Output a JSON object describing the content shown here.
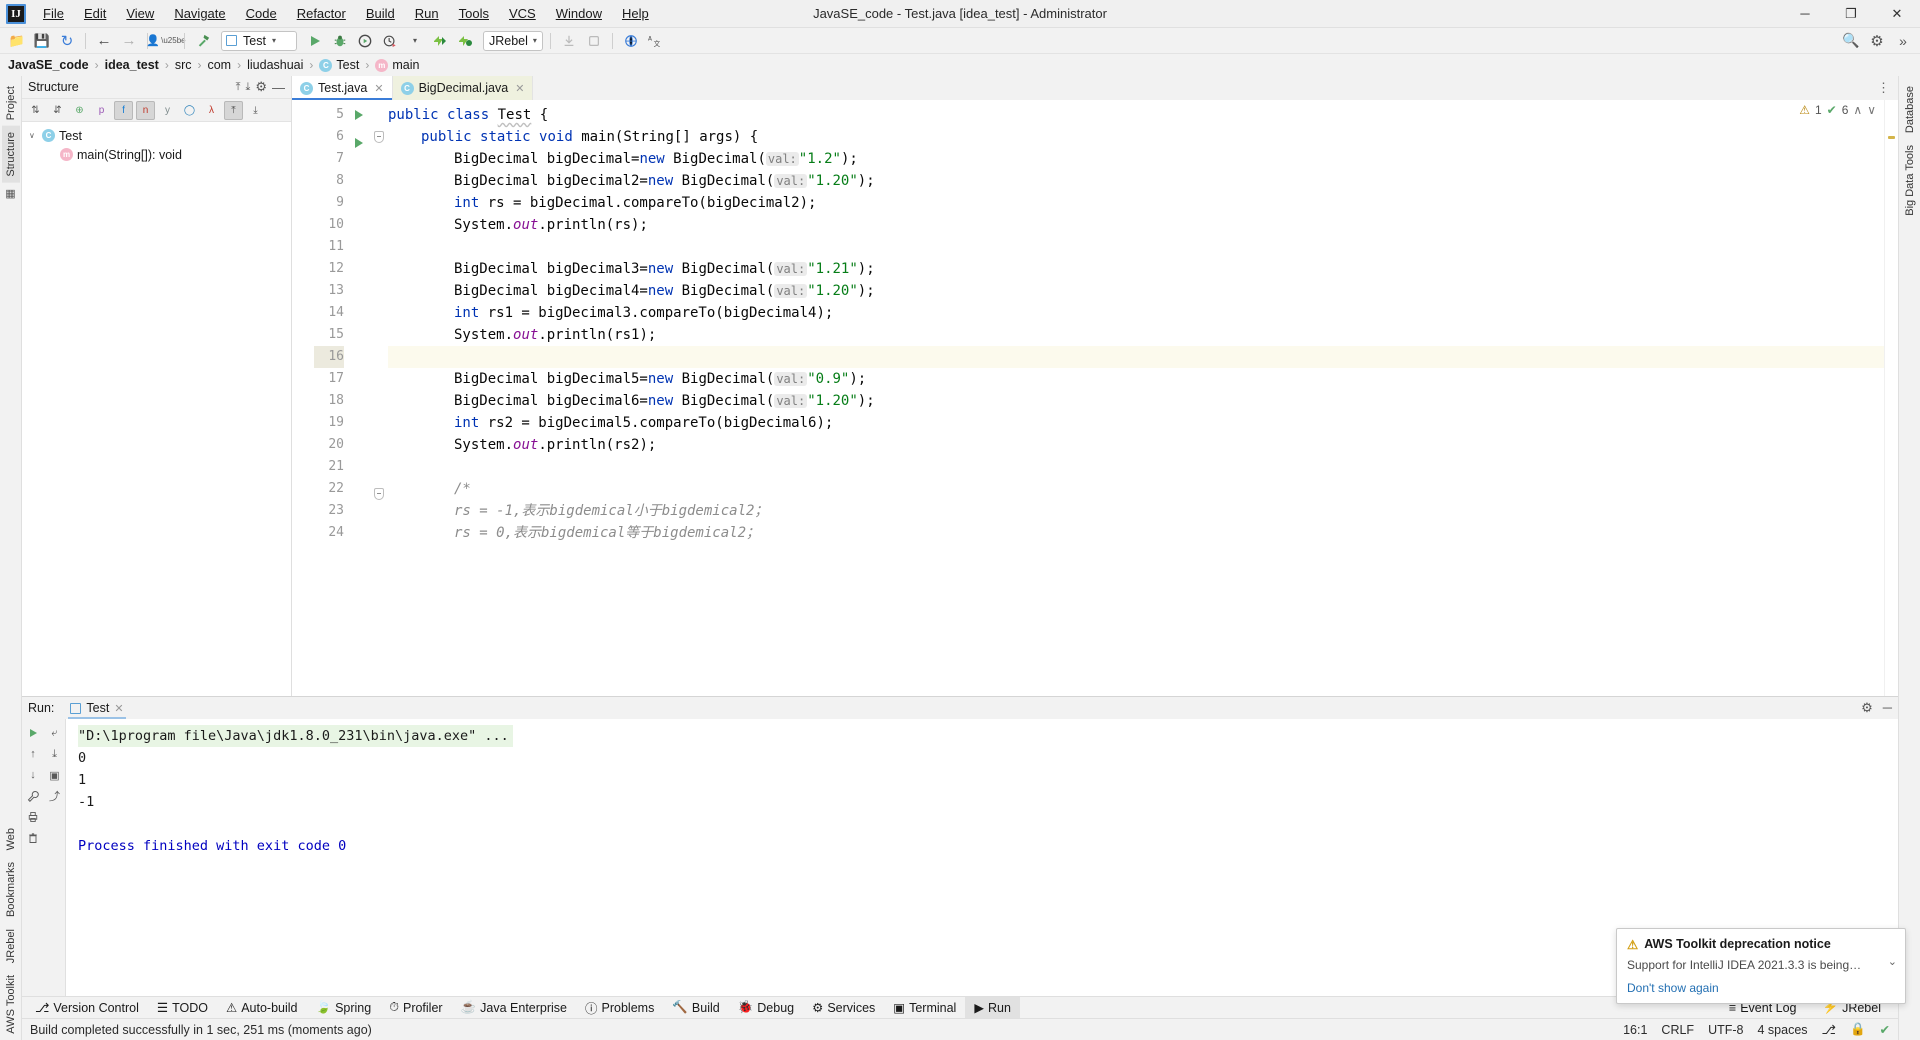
{
  "titlebar": {
    "logo": "IJ",
    "window_title": "JavaSE_code - Test.java [idea_test] - Administrator",
    "menu": [
      {
        "label": "File"
      },
      {
        "label": "Edit"
      },
      {
        "label": "View"
      },
      {
        "label": "Navigate"
      },
      {
        "label": "Code"
      },
      {
        "label": "Refactor"
      },
      {
        "label": "Build"
      },
      {
        "label": "Run"
      },
      {
        "label": "Tools"
      },
      {
        "label": "VCS"
      },
      {
        "label": "Window"
      },
      {
        "label": "Help"
      }
    ],
    "minimize": "─",
    "maximize": "❐",
    "close": "✕"
  },
  "toolbar": {
    "open_icon": "📁",
    "save_icon": "💾",
    "sync_icon": "↻",
    "back_icon": "←",
    "forward_icon": "→",
    "profile_icon": "👤",
    "build_icon": "🔨",
    "run_config_name": "Test",
    "run_icon": "▶",
    "debug_icon": "🐞",
    "run_coverage_icon": "▶",
    "profiler_icon": "⏱",
    "jrebel_run_icon": "⚡",
    "jrebel_debug_icon": "⚡",
    "jrebel_label": "JRebel",
    "search_icon": "🔍",
    "settings_icon": "⚙",
    "expand_icon": "»"
  },
  "breadcrumb": {
    "items": [
      {
        "label": "JavaSE_code",
        "bold": true,
        "icon": null
      },
      {
        "label": "idea_test",
        "bold": true,
        "icon": null
      },
      {
        "label": "src",
        "bold": false,
        "icon": null
      },
      {
        "label": "com",
        "bold": false,
        "icon": null
      },
      {
        "label": "liudashuai",
        "bold": false,
        "icon": null
      },
      {
        "label": "Test",
        "bold": false,
        "icon": "C"
      },
      {
        "label": "main",
        "bold": false,
        "icon": "m"
      }
    ],
    "separator": "›"
  },
  "left_strip": {
    "project_tab": "Project",
    "structure_tab": "Structure",
    "bottom_tabs": [
      "Web",
      "Bookmarks",
      "JRebel",
      "AWS Toolkit"
    ],
    "icons": [
      "pin-icon",
      "star-icon"
    ]
  },
  "right_strip": {
    "tabs": [
      "Database",
      "Big Data Tools"
    ]
  },
  "structure": {
    "title": "Structure",
    "header_actions": [
      "collapse-all-icon",
      "expand-all-icon",
      "gear-icon",
      "hide-icon"
    ],
    "toolbar_buttons": [
      "sort-alpha-icon",
      "sort-visibility-icon",
      "show-inherited-icon",
      "show-properties-icon",
      "show-fields-icon",
      "show-non-public-icon",
      "group-methods-icon",
      "show-anonymous-icon",
      "autoscroll-from-icon",
      "expand-all-icon",
      "collapse-all-icon"
    ],
    "tree": [
      {
        "label": "Test",
        "icon": "C",
        "indent": 0,
        "twisty": "∨"
      },
      {
        "label": "main(String[]): void",
        "icon": "m",
        "indent": 1,
        "twisty": ""
      }
    ]
  },
  "editor": {
    "tabs": [
      {
        "label": "Test.java",
        "icon": "C",
        "active": true,
        "close": "✕"
      },
      {
        "label": "BigDecimal.java",
        "icon": "C",
        "active": false,
        "close": "✕"
      }
    ],
    "status": {
      "warning_count": "1",
      "ok_count": "6",
      "warning_icon": "⚠",
      "ok_icon": "✔",
      "up_icon": "∧",
      "down_icon": "∨"
    },
    "first_line_number": 5,
    "highlighted_line": 16,
    "lines": [
      {
        "n": 5,
        "run": true,
        "fold": false,
        "indent": 0,
        "tokens": [
          {
            "t": "public ",
            "c": "kw"
          },
          {
            "t": "class ",
            "c": "kw"
          },
          {
            "t": "Test",
            "c": "typo"
          },
          {
            "t": " {",
            "c": ""
          }
        ]
      },
      {
        "n": 6,
        "run": true,
        "fold": true,
        "indent": 1,
        "tokens": [
          {
            "t": "public ",
            "c": "kw"
          },
          {
            "t": "static ",
            "c": "kw"
          },
          {
            "t": "void ",
            "c": "kw"
          },
          {
            "t": "main",
            "c": "mth"
          },
          {
            "t": "(String[] args) {",
            "c": ""
          }
        ]
      },
      {
        "n": 7,
        "run": false,
        "fold": false,
        "indent": 2,
        "tokens": [
          {
            "t": "BigDecimal bigDecimal=",
            "c": ""
          },
          {
            "t": "new ",
            "c": "kw"
          },
          {
            "t": "BigDecimal(",
            "c": ""
          },
          {
            "t": " val: ",
            "c": "hint"
          },
          {
            "t": "\"1.2\"",
            "c": "str"
          },
          {
            "t": ");",
            "c": ""
          }
        ]
      },
      {
        "n": 8,
        "run": false,
        "fold": false,
        "indent": 2,
        "tokens": [
          {
            "t": "BigDecimal bigDecimal2=",
            "c": ""
          },
          {
            "t": "new ",
            "c": "kw"
          },
          {
            "t": "BigDecimal(",
            "c": ""
          },
          {
            "t": " val: ",
            "c": "hint"
          },
          {
            "t": "\"1.20\"",
            "c": "str"
          },
          {
            "t": ");",
            "c": ""
          }
        ]
      },
      {
        "n": 9,
        "run": false,
        "fold": false,
        "indent": 2,
        "tokens": [
          {
            "t": "int ",
            "c": "kw"
          },
          {
            "t": "rs = bigDecimal.compareTo(bigDecimal2);",
            "c": ""
          }
        ]
      },
      {
        "n": 10,
        "run": false,
        "fold": false,
        "indent": 2,
        "tokens": [
          {
            "t": "System.",
            "c": ""
          },
          {
            "t": "out",
            "c": "fld"
          },
          {
            "t": ".println(rs);",
            "c": ""
          }
        ]
      },
      {
        "n": 11,
        "run": false,
        "fold": false,
        "indent": 2,
        "tokens": []
      },
      {
        "n": 12,
        "run": false,
        "fold": false,
        "indent": 2,
        "tokens": [
          {
            "t": "BigDecimal bigDecimal3=",
            "c": ""
          },
          {
            "t": "new ",
            "c": "kw"
          },
          {
            "t": "BigDecimal(",
            "c": ""
          },
          {
            "t": " val: ",
            "c": "hint"
          },
          {
            "t": "\"1.21\"",
            "c": "str"
          },
          {
            "t": ");",
            "c": ""
          }
        ]
      },
      {
        "n": 13,
        "run": false,
        "fold": false,
        "indent": 2,
        "tokens": [
          {
            "t": "BigDecimal bigDecimal4=",
            "c": ""
          },
          {
            "t": "new ",
            "c": "kw"
          },
          {
            "t": "BigDecimal(",
            "c": ""
          },
          {
            "t": " val: ",
            "c": "hint"
          },
          {
            "t": "\"1.20\"",
            "c": "str"
          },
          {
            "t": ");",
            "c": ""
          }
        ]
      },
      {
        "n": 14,
        "run": false,
        "fold": false,
        "indent": 2,
        "tokens": [
          {
            "t": "int ",
            "c": "kw"
          },
          {
            "t": "rs1 = bigDecimal3.compareTo(bigDecimal4);",
            "c": ""
          }
        ]
      },
      {
        "n": 15,
        "run": false,
        "fold": false,
        "indent": 2,
        "tokens": [
          {
            "t": "System.",
            "c": ""
          },
          {
            "t": "out",
            "c": "fld"
          },
          {
            "t": ".println(rs1);",
            "c": ""
          }
        ]
      },
      {
        "n": 16,
        "run": false,
        "fold": false,
        "indent": 2,
        "tokens": []
      },
      {
        "n": 17,
        "run": false,
        "fold": false,
        "indent": 2,
        "tokens": [
          {
            "t": "BigDecimal bigDecimal5=",
            "c": ""
          },
          {
            "t": "new ",
            "c": "kw"
          },
          {
            "t": "BigDecimal(",
            "c": ""
          },
          {
            "t": " val: ",
            "c": "hint"
          },
          {
            "t": "\"0.9\"",
            "c": "str"
          },
          {
            "t": ");",
            "c": ""
          }
        ]
      },
      {
        "n": 18,
        "run": false,
        "fold": false,
        "indent": 2,
        "tokens": [
          {
            "t": "BigDecimal bigDecimal6=",
            "c": ""
          },
          {
            "t": "new ",
            "c": "kw"
          },
          {
            "t": "BigDecimal(",
            "c": ""
          },
          {
            "t": " val: ",
            "c": "hint"
          },
          {
            "t": "\"1.20\"",
            "c": "str"
          },
          {
            "t": ");",
            "c": ""
          }
        ]
      },
      {
        "n": 19,
        "run": false,
        "fold": false,
        "indent": 2,
        "tokens": [
          {
            "t": "int ",
            "c": "kw"
          },
          {
            "t": "rs2 = bigDecimal5.compareTo(bigDecimal6);",
            "c": ""
          }
        ]
      },
      {
        "n": 20,
        "run": false,
        "fold": false,
        "indent": 2,
        "tokens": [
          {
            "t": "System.",
            "c": ""
          },
          {
            "t": "out",
            "c": "fld"
          },
          {
            "t": ".println(rs2);",
            "c": ""
          }
        ]
      },
      {
        "n": 21,
        "run": false,
        "fold": false,
        "indent": 2,
        "tokens": []
      },
      {
        "n": 22,
        "run": false,
        "fold": true,
        "indent": 2,
        "tokens": [
          {
            "t": "/*",
            "c": "cmt"
          }
        ]
      },
      {
        "n": 23,
        "run": false,
        "fold": false,
        "indent": 2,
        "tokens": [
          {
            "t": "rs = -1,表示bigdemical小于bigdemical2；",
            "c": "cmt"
          }
        ]
      },
      {
        "n": 24,
        "run": false,
        "fold": false,
        "indent": 2,
        "tokens": [
          {
            "t": "rs = 0,表示bigdemical等于bigdemical2；",
            "c": "cmt"
          }
        ]
      }
    ]
  },
  "run_panel": {
    "label": "Run:",
    "tab_label": "Test",
    "tab_close": "✕",
    "settings_icon": "⚙",
    "hide_icon": "─",
    "side_buttons": [
      "rerun-icon",
      "scroll-up-icon",
      "scroll-down-icon",
      "wrench-icon",
      "print-icon",
      "trash-icon"
    ],
    "side_buttons_glyphs": [
      "▶",
      "↑",
      "↓",
      "🔧",
      "🖨",
      "🗑"
    ],
    "console": [
      {
        "text": "\"D:\\1program file\\Java\\jdk1.8.0_231\\bin\\java.exe\" ...",
        "style": "cmd"
      },
      {
        "text": "0",
        "style": "plain"
      },
      {
        "text": "1",
        "style": "plain"
      },
      {
        "text": "-1",
        "style": "plain"
      },
      {
        "text": "",
        "style": "plain"
      },
      {
        "text": "Process finished with exit code 0",
        "style": "exit"
      }
    ]
  },
  "notification": {
    "icon": "⚠",
    "title": "AWS Toolkit deprecation notice",
    "body": "Support for IntelliJ IDEA 2021.3.3 is being…",
    "link": "Don't show again",
    "chevron": "⌄"
  },
  "bottom_bar": {
    "items": [
      {
        "label": "Version Control",
        "icon": "⎇"
      },
      {
        "label": "TODO",
        "icon": "☰"
      },
      {
        "label": "Auto-build",
        "icon": "⚠"
      },
      {
        "label": "Spring",
        "icon": "🍃"
      },
      {
        "label": "Profiler",
        "icon": "⏱"
      },
      {
        "label": "Java Enterprise",
        "icon": "☕"
      },
      {
        "label": "Problems",
        "icon": "ⓘ"
      },
      {
        "label": "Build",
        "icon": "🔨"
      },
      {
        "label": "Debug",
        "icon": "🐞"
      },
      {
        "label": "Services",
        "icon": "⚙"
      },
      {
        "label": "Terminal",
        "icon": "▣"
      },
      {
        "label": "Run",
        "icon": "▶",
        "active": true
      }
    ],
    "right": [
      {
        "label": "Event Log",
        "icon": "≡"
      },
      {
        "label": "JRebel",
        "icon": "⚡"
      }
    ]
  },
  "statusbar": {
    "message": "Build completed successfully in 1 sec, 251 ms (moments ago)",
    "caret": "16:1",
    "line_sep": "CRLF",
    "encoding": "UTF-8",
    "indent": "4 spaces",
    "branch_icon": "⎇",
    "lock_icon": "🔒",
    "inspection_icon": "✔"
  }
}
